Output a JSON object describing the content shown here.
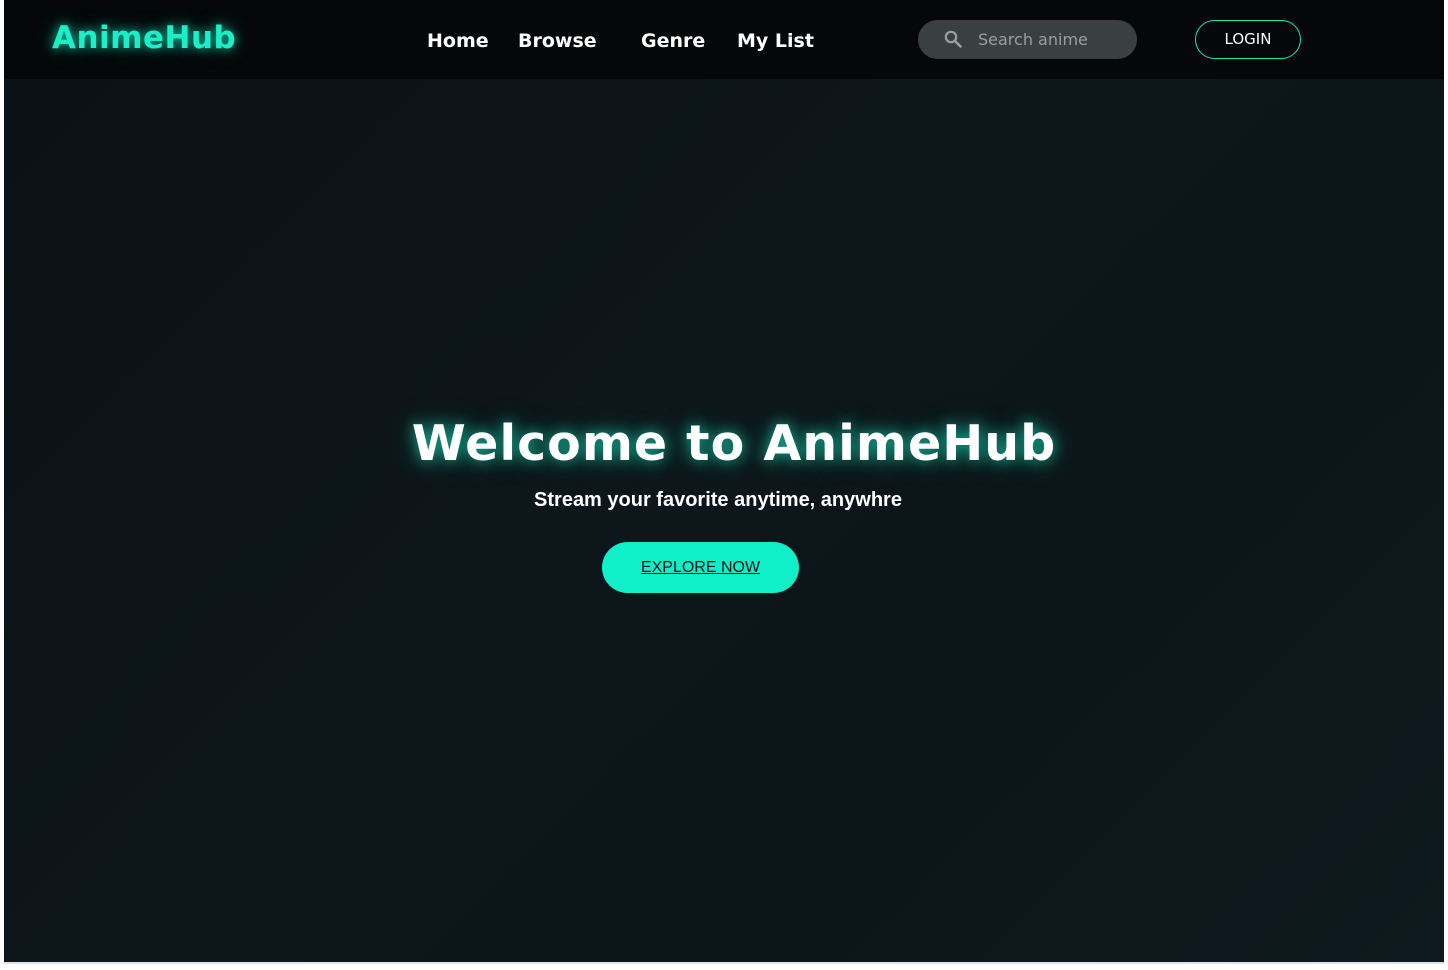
{
  "navbar": {
    "logo": "AnimeHub",
    "links": [
      {
        "label": "Home"
      },
      {
        "label": "Browse"
      },
      {
        "label": "Genre"
      },
      {
        "label": "My List"
      }
    ],
    "search": {
      "placeholder": "Search anime",
      "value": "",
      "icon": "search-icon"
    },
    "login_label": "LOGIN"
  },
  "hero": {
    "title": "Welcome to AnimeHub",
    "subtitle": "Stream your favorite anytime, anywhre",
    "cta_label": "EXPLORE NOW"
  },
  "colors": {
    "accent": "#19f0c8",
    "navbar_bg": "#050708",
    "page_bg": "#0b1317",
    "search_bg": "#3a3f42"
  }
}
